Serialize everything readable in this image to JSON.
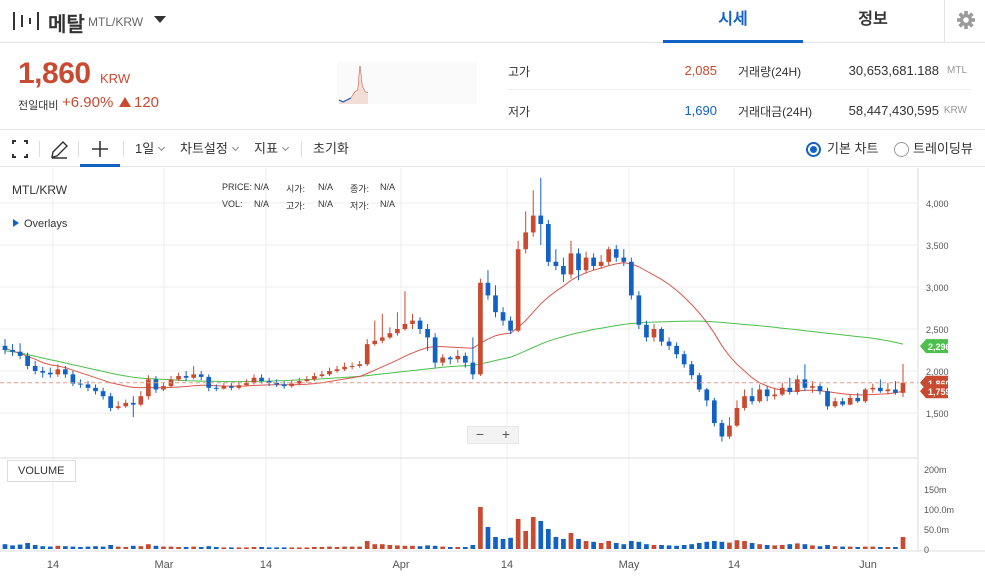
{
  "header": {
    "coin_name": "메탈",
    "pair": "MTL/KRW",
    "tabs": [
      "시세",
      "정보"
    ]
  },
  "summary": {
    "price": "1,860",
    "unit": "KRW",
    "change_label": "전일대비",
    "change_rate": "+6.90%",
    "change_amount": "120",
    "high_label": "고가",
    "high_value": "2,085",
    "low_label": "저가",
    "low_value": "1,690",
    "volume_label": "거래량(24H)",
    "volume_value": "30,653,681.188",
    "volume_unit": "MTL",
    "turnover_label": "거래대금(24H)",
    "turnover_value": "58,447,430,595",
    "turnover_unit": "KRW"
  },
  "toolbar": {
    "interval": "1일",
    "chart_settings": "차트설정",
    "indicators": "지표",
    "reset": "초기화",
    "basic_chart": "기본 차트",
    "trading_view": "트레이딩뷰"
  },
  "chart": {
    "symbol": "MTL/KRW",
    "overlays": "Overlays",
    "ohlc_labels": [
      "PRICE:",
      "N/A",
      "시가:",
      "N/A",
      "종가:",
      "N/A",
      "VOL:",
      "N/A",
      "고가:",
      "N/A",
      "저가:",
      "N/A"
    ],
    "volume_label": "VOLUME",
    "zoom_minus": "−",
    "zoom_plus": "+"
  },
  "colors": {
    "up": "#c84a31",
    "down": "#1261c4",
    "accent": "#1261c4",
    "ma_short": "#d9574c",
    "ma_long": "#4cbf4c"
  },
  "chart_data": {
    "type": "candlestick",
    "price_axis_ticks": [
      "4,000",
      "3,500",
      "3,000",
      "2,500",
      "2,000",
      "1,500"
    ],
    "volume_axis_ticks": [
      "200m",
      "150m",
      "100.0m",
      "50.0m",
      "0"
    ],
    "x_tick_labels": [
      "14",
      "Mar",
      "14",
      "Apr",
      "14",
      "May",
      "14",
      "Jun"
    ],
    "ylim": [
      1100,
      4300
    ],
    "current_price": 1860,
    "price_tags": [
      {
        "label": "2,296",
        "value": 2296,
        "color": "#4cbf4c"
      },
      {
        "label": "1,860",
        "value": 1860,
        "color": "#c84a31"
      },
      {
        "label": "1,759",
        "value": 1759,
        "color": "#c84a31"
      }
    ],
    "candles": [
      [
        2300,
        2250,
        2380,
        2200,
        12
      ],
      [
        2250,
        2230,
        2320,
        2180,
        9
      ],
      [
        2230,
        2180,
        2330,
        2140,
        11
      ],
      [
        2180,
        2060,
        2220,
        2020,
        15
      ],
      [
        2060,
        2000,
        2120,
        1960,
        10
      ],
      [
        2000,
        1980,
        2050,
        1920,
        7
      ],
      [
        1980,
        1960,
        2040,
        1920,
        6
      ],
      [
        1960,
        2020,
        2080,
        1930,
        8
      ],
      [
        2020,
        1960,
        2060,
        1920,
        7
      ],
      [
        1960,
        1850,
        2000,
        1820,
        6
      ],
      [
        1850,
        1840,
        1900,
        1800,
        5
      ],
      [
        1840,
        1800,
        1880,
        1760,
        6
      ],
      [
        1800,
        1760,
        1840,
        1720,
        7
      ],
      [
        1760,
        1700,
        1800,
        1660,
        6
      ],
      [
        1700,
        1560,
        1740,
        1520,
        10
      ],
      [
        1560,
        1580,
        1640,
        1540,
        6
      ],
      [
        1580,
        1620,
        1660,
        1560,
        5
      ],
      [
        1620,
        1600,
        1700,
        1450,
        8
      ],
      [
        1600,
        1700,
        1760,
        1580,
        7
      ],
      [
        1700,
        1900,
        1950,
        1660,
        12
      ],
      [
        1900,
        1780,
        1940,
        1740,
        8
      ],
      [
        1780,
        1820,
        1860,
        1760,
        6
      ],
      [
        1820,
        1900,
        1940,
        1800,
        6
      ],
      [
        1900,
        1940,
        1980,
        1880,
        5
      ],
      [
        1940,
        1920,
        2000,
        1880,
        5
      ],
      [
        1920,
        1960,
        2060,
        1900,
        6
      ],
      [
        1960,
        1930,
        2000,
        1890,
        5
      ],
      [
        1930,
        1800,
        1960,
        1760,
        7
      ],
      [
        1800,
        1790,
        1840,
        1760,
        5
      ],
      [
        1790,
        1820,
        1860,
        1780,
        4
      ],
      [
        1820,
        1800,
        1860,
        1770,
        4
      ],
      [
        1800,
        1830,
        1870,
        1780,
        4
      ],
      [
        1830,
        1860,
        1900,
        1820,
        4
      ],
      [
        1860,
        1920,
        1960,
        1840,
        5
      ],
      [
        1920,
        1880,
        1960,
        1850,
        5
      ],
      [
        1880,
        1860,
        1920,
        1820,
        4
      ],
      [
        1860,
        1840,
        1900,
        1810,
        4
      ],
      [
        1840,
        1820,
        1880,
        1790,
        4
      ],
      [
        1820,
        1850,
        1890,
        1800,
        4
      ],
      [
        1850,
        1880,
        1920,
        1830,
        4
      ],
      [
        1880,
        1900,
        1940,
        1860,
        4
      ],
      [
        1900,
        1940,
        1980,
        1880,
        5
      ],
      [
        1940,
        1960,
        2000,
        1920,
        5
      ],
      [
        1960,
        2000,
        2040,
        1940,
        6
      ],
      [
        2000,
        2020,
        2060,
        1980,
        5
      ],
      [
        2020,
        2050,
        2100,
        2000,
        6
      ],
      [
        2050,
        2060,
        2100,
        2020,
        6
      ],
      [
        2060,
        2080,
        2120,
        2040,
        6
      ],
      [
        2080,
        2320,
        2380,
        2060,
        20
      ],
      [
        2320,
        2360,
        2600,
        2300,
        12
      ],
      [
        2360,
        2400,
        2680,
        2330,
        12
      ],
      [
        2400,
        2450,
        2520,
        2380,
        10
      ],
      [
        2450,
        2500,
        2700,
        2420,
        9
      ],
      [
        2500,
        2560,
        2950,
        2480,
        8
      ],
      [
        2560,
        2600,
        2680,
        2500,
        8
      ],
      [
        2600,
        2500,
        2640,
        2440,
        7
      ],
      [
        2500,
        2400,
        2560,
        2240,
        9
      ],
      [
        2400,
        2100,
        2450,
        2040,
        8
      ],
      [
        2100,
        2160,
        2200,
        2060,
        6
      ],
      [
        2160,
        2140,
        2180,
        2080,
        5
      ],
      [
        2140,
        2180,
        2250,
        2100,
        5
      ],
      [
        2180,
        2100,
        2220,
        2040,
        5
      ],
      [
        2100,
        1960,
        2400,
        1900,
        10
      ],
      [
        1960,
        3050,
        3100,
        1940,
        105
      ],
      [
        3050,
        2900,
        3200,
        2850,
        55
      ],
      [
        2900,
        2700,
        3020,
        2640,
        30
      ],
      [
        2700,
        2600,
        2760,
        2540,
        25
      ],
      [
        2600,
        2480,
        2650,
        2440,
        28
      ],
      [
        2480,
        3450,
        3550,
        2460,
        75
      ],
      [
        3450,
        3650,
        3900,
        3400,
        45
      ],
      [
        3650,
        3850,
        4150,
        3600,
        80
      ],
      [
        3850,
        3750,
        4300,
        3500,
        70
      ],
      [
        3750,
        3300,
        3800,
        3250,
        50
      ],
      [
        3300,
        3250,
        3450,
        3200,
        30
      ],
      [
        3250,
        3150,
        3350,
        3060,
        25
      ],
      [
        3150,
        3400,
        3550,
        3100,
        40
      ],
      [
        3400,
        3200,
        3460,
        3080,
        25
      ],
      [
        3200,
        3350,
        3420,
        3160,
        20
      ],
      [
        3350,
        3250,
        3400,
        3200,
        18
      ],
      [
        3250,
        3300,
        3380,
        3220,
        15
      ],
      [
        3300,
        3450,
        3480,
        3260,
        20
      ],
      [
        3450,
        3350,
        3500,
        3300,
        15
      ],
      [
        3350,
        3300,
        3450,
        3250,
        12
      ],
      [
        3300,
        2900,
        3350,
        2850,
        20
      ],
      [
        2900,
        2550,
        2950,
        2500,
        18
      ],
      [
        2550,
        2400,
        2600,
        2350,
        12
      ],
      [
        2400,
        2500,
        2560,
        2350,
        10
      ],
      [
        2500,
        2350,
        2520,
        2300,
        10
      ],
      [
        2350,
        2300,
        2400,
        2250,
        9
      ],
      [
        2300,
        2200,
        2340,
        2150,
        8
      ],
      [
        2200,
        2080,
        2240,
        2040,
        10
      ],
      [
        2080,
        1950,
        2120,
        1900,
        12
      ],
      [
        1950,
        1780,
        1980,
        1750,
        15
      ],
      [
        1780,
        1650,
        1800,
        1580,
        18
      ],
      [
        1650,
        1380,
        1680,
        1340,
        20
      ],
      [
        1380,
        1220,
        1420,
        1160,
        18
      ],
      [
        1220,
        1350,
        1450,
        1190,
        16
      ],
      [
        1350,
        1560,
        1650,
        1330,
        22
      ],
      [
        1560,
        1700,
        1780,
        1530,
        20
      ],
      [
        1700,
        1640,
        1800,
        1600,
        15
      ],
      [
        1640,
        1780,
        1840,
        1620,
        12
      ],
      [
        1780,
        1700,
        1820,
        1640,
        10
      ],
      [
        1700,
        1720,
        1800,
        1660,
        9
      ],
      [
        1720,
        1800,
        1860,
        1700,
        10
      ],
      [
        1800,
        1750,
        1920,
        1720,
        12
      ],
      [
        1750,
        1900,
        1950,
        1720,
        14
      ],
      [
        1900,
        1800,
        2080,
        1760,
        12
      ],
      [
        1800,
        1820,
        1880,
        1740,
        9
      ],
      [
        1820,
        1760,
        1850,
        1720,
        7
      ],
      [
        1760,
        1580,
        1800,
        1540,
        10
      ],
      [
        1580,
        1640,
        1680,
        1560,
        7
      ],
      [
        1640,
        1600,
        1680,
        1580,
        6
      ],
      [
        1600,
        1680,
        1720,
        1590,
        6
      ],
      [
        1680,
        1640,
        1740,
        1620,
        5
      ],
      [
        1640,
        1780,
        1800,
        1620,
        6
      ],
      [
        1780,
        1800,
        1850,
        1740,
        6
      ],
      [
        1800,
        1760,
        1900,
        1740,
        5
      ],
      [
        1760,
        1780,
        1860,
        1720,
        5
      ],
      [
        1780,
        1740,
        1880,
        1720,
        5
      ],
      [
        1740,
        1860,
        2085,
        1690,
        30
      ]
    ],
    "ma_short": [
      2270,
      2240,
      2210,
      2175,
      2140,
      2100,
      2075,
      2060,
      2040,
      2010,
      1980,
      1950,
      1920,
      1890,
      1860,
      1840,
      1820,
      1805,
      1800,
      1805,
      1800,
      1800,
      1805,
      1810,
      1815,
      1825,
      1830,
      1830,
      1825,
      1822,
      1820,
      1820,
      1822,
      1828,
      1832,
      1835,
      1836,
      1836,
      1836,
      1838,
      1842,
      1850,
      1860,
      1875,
      1890,
      1905,
      1920,
      1935,
      1970,
      2010,
      2050,
      2090,
      2130,
      2175,
      2215,
      2250,
      2280,
      2290,
      2290,
      2285,
      2280,
      2275,
      2270,
      2330,
      2380,
      2420,
      2440,
      2450,
      2520,
      2600,
      2700,
      2800,
      2880,
      2950,
      3010,
      3080,
      3130,
      3170,
      3200,
      3225,
      3255,
      3275,
      3290,
      3275,
      3240,
      3190,
      3140,
      3090,
      3030,
      2960,
      2880,
      2790,
      2690,
      2580,
      2450,
      2300,
      2180,
      2080,
      2000,
      1920,
      1860,
      1820,
      1790,
      1770,
      1760,
      1762,
      1770,
      1770,
      1765,
      1755,
      1740,
      1730,
      1720,
      1715,
      1715,
      1720,
      1725,
      1730,
      1740,
      1760
    ],
    "ma_long": [
      2240,
      2230,
      2215,
      2195,
      2175,
      2155,
      2135,
      2115,
      2095,
      2075,
      2055,
      2035,
      2015,
      1995,
      1975,
      1955,
      1940,
      1925,
      1915,
      1910,
      1905,
      1900,
      1895,
      1890,
      1885,
      1882,
      1880,
      1878,
      1876,
      1875,
      1874,
      1874,
      1875,
      1876,
      1878,
      1880,
      1883,
      1886,
      1890,
      1894,
      1898,
      1902,
      1906,
      1912,
      1918,
      1924,
      1930,
      1936,
      1945,
      1955,
      1965,
      1975,
      1985,
      1995,
      2005,
      2015,
      2025,
      2035,
      2045,
      2052,
      2058,
      2062,
      2066,
      2085,
      2105,
      2125,
      2145,
      2165,
      2200,
      2240,
      2280,
      2320,
      2355,
      2385,
      2410,
      2435,
      2455,
      2475,
      2495,
      2510,
      2525,
      2540,
      2555,
      2565,
      2572,
      2578,
      2582,
      2585,
      2588,
      2590,
      2592,
      2594,
      2594,
      2590,
      2585,
      2578,
      2570,
      2562,
      2554,
      2546,
      2538,
      2530,
      2520,
      2510,
      2500,
      2490,
      2480,
      2470,
      2460,
      2450,
      2440,
      2430,
      2420,
      2410,
      2400,
      2390,
      2375,
      2360,
      2340,
      2320
    ]
  }
}
